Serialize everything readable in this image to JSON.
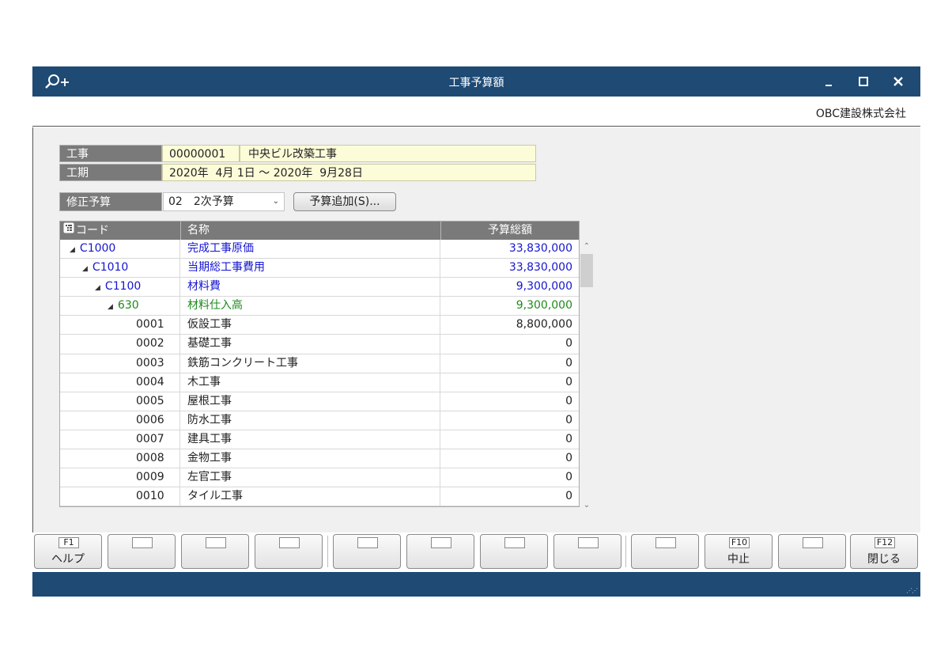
{
  "window": {
    "title": "工事予算額",
    "company": "OBC建設株式会社",
    "icons": {
      "app": "search-plus-icon",
      "minimize": "minimize-icon",
      "maximize": "maximize-icon",
      "close": "close-icon"
    }
  },
  "header": {
    "project_label": "工事",
    "project_code": "00000001",
    "project_name": "中央ビル改築工事",
    "period_label": "工期",
    "period_value": "2020年  4月 1日 ～ 2020年  9月28日"
  },
  "revision": {
    "label": "修正予算",
    "selected": "02　2次予算",
    "add_button": "予算追加(S)..."
  },
  "grid": {
    "columns": {
      "code": "コード",
      "name": "名称",
      "amount": "予算総額"
    },
    "rows": [
      {
        "level": 0,
        "expander": "◢",
        "code": "C1000",
        "name": "完成工事原価",
        "amount": "33,830,000",
        "color": "#1515d0"
      },
      {
        "level": 1,
        "expander": "◢",
        "code": "C1010",
        "name": "当期総工事費用",
        "amount": "33,830,000",
        "color": "#1515d0"
      },
      {
        "level": 2,
        "expander": "◢",
        "code": "C1100",
        "name": "材料費",
        "amount": "9,300,000",
        "color": "#1515d0"
      },
      {
        "level": 3,
        "expander": "◢",
        "code": "630",
        "name": "材料仕入高",
        "amount": "9,300,000",
        "color": "#1c8a1c"
      },
      {
        "level": 4,
        "expander": "",
        "code": "0001",
        "name": "仮設工事",
        "amount": "8,800,000",
        "color": "#222222"
      },
      {
        "level": 4,
        "expander": "",
        "code": "0002",
        "name": "基礎工事",
        "amount": "0",
        "color": "#222222"
      },
      {
        "level": 4,
        "expander": "",
        "code": "0003",
        "name": "鉄筋コンクリート工事",
        "amount": "0",
        "color": "#222222"
      },
      {
        "level": 4,
        "expander": "",
        "code": "0004",
        "name": "木工事",
        "amount": "0",
        "color": "#222222"
      },
      {
        "level": 4,
        "expander": "",
        "code": "0005",
        "name": "屋根工事",
        "amount": "0",
        "color": "#222222"
      },
      {
        "level": 4,
        "expander": "",
        "code": "0006",
        "name": "防水工事",
        "amount": "0",
        "color": "#222222"
      },
      {
        "level": 4,
        "expander": "",
        "code": "0007",
        "name": "建具工事",
        "amount": "0",
        "color": "#222222"
      },
      {
        "level": 4,
        "expander": "",
        "code": "0008",
        "name": "金物工事",
        "amount": "0",
        "color": "#222222"
      },
      {
        "level": 4,
        "expander": "",
        "code": "0009",
        "name": "左官工事",
        "amount": "0",
        "color": "#222222"
      },
      {
        "level": 4,
        "expander": "",
        "code": "0010",
        "name": "タイル工事",
        "amount": "0",
        "color": "#222222"
      }
    ]
  },
  "function_keys": [
    {
      "key": "F1",
      "label": "ヘルプ"
    },
    {
      "key": "",
      "label": ""
    },
    {
      "key": "",
      "label": ""
    },
    {
      "key": "",
      "label": ""
    },
    {
      "key": "",
      "label": ""
    },
    {
      "key": "",
      "label": ""
    },
    {
      "key": "",
      "label": ""
    },
    {
      "key": "",
      "label": ""
    },
    {
      "key": "",
      "label": ""
    },
    {
      "key": "F10",
      "label": "中止"
    },
    {
      "key": "",
      "label": ""
    },
    {
      "key": "F12",
      "label": "閉じる"
    }
  ],
  "colors": {
    "titlebar": "#1e4a74",
    "header_label_bg": "#7a7a7a",
    "header_value_bg": "#fdfcd8",
    "account_blue": "#1515d0",
    "account_green": "#1c8a1c"
  }
}
